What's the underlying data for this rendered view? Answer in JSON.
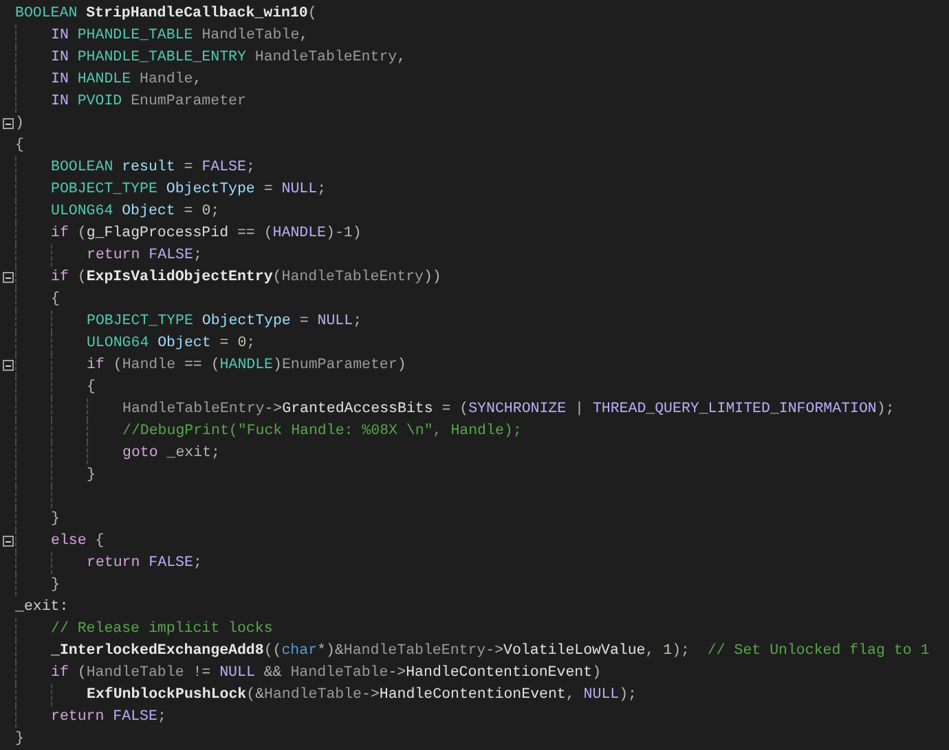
{
  "editor": {
    "lines": [
      {
        "kind": "code",
        "tokens": [
          {
            "text": "BOOLEAN ",
            "kind": "type"
          },
          {
            "text": "StripHandleCallback_win10",
            "kind": "function"
          },
          {
            "text": "(",
            "kind": "plain"
          }
        ],
        "children": [
          {
            "kind": "code",
            "tokens": [
              {
                "text": "IN ",
                "kind": "macro"
              },
              {
                "text": "PHANDLE_TABLE ",
                "kind": "type"
              },
              {
                "text": "HandleTable",
                "kind": "param"
              },
              {
                "text": ",",
                "kind": "plain"
              }
            ]
          },
          {
            "kind": "code",
            "tokens": [
              {
                "text": "IN ",
                "kind": "macro"
              },
              {
                "text": "PHANDLE_TABLE_ENTRY ",
                "kind": "type"
              },
              {
                "text": "HandleTableEntry",
                "kind": "param"
              },
              {
                "text": ",",
                "kind": "plain"
              }
            ]
          },
          {
            "kind": "code",
            "tokens": [
              {
                "text": "IN ",
                "kind": "macro"
              },
              {
                "text": "HANDLE ",
                "kind": "type"
              },
              {
                "text": "Handle",
                "kind": "param"
              },
              {
                "text": ",",
                "kind": "plain"
              }
            ]
          },
          {
            "kind": "code",
            "tokens": [
              {
                "text": "IN ",
                "kind": "macro"
              },
              {
                "text": "PVOID ",
                "kind": "type"
              },
              {
                "text": "EnumParameter",
                "kind": "param"
              }
            ]
          }
        ]
      },
      {
        "kind": "code",
        "expanded": true,
        "tokens": [
          {
            "text": ")",
            "kind": "plain"
          }
        ]
      },
      {
        "kind": "code",
        "tokens": [
          {
            "text": "{",
            "kind": "plain"
          }
        ],
        "children": [
          {
            "kind": "code",
            "tokens": [
              {
                "text": "BOOLEAN ",
                "kind": "type"
              },
              {
                "text": "result",
                "kind": "local"
              },
              {
                "text": " = ",
                "kind": "plain"
              },
              {
                "text": "FALSE",
                "kind": "macro"
              },
              {
                "text": ";",
                "kind": "plain"
              }
            ]
          },
          {
            "kind": "code",
            "tokens": [
              {
                "text": "POBJECT_TYPE ",
                "kind": "type"
              },
              {
                "text": "ObjectType",
                "kind": "local"
              },
              {
                "text": " = ",
                "kind": "plain"
              },
              {
                "text": "NULL",
                "kind": "macro"
              },
              {
                "text": ";",
                "kind": "plain"
              }
            ]
          },
          {
            "kind": "code",
            "tokens": [
              {
                "text": "ULONG64 ",
                "kind": "type"
              },
              {
                "text": "Object",
                "kind": "local"
              },
              {
                "text": " = ",
                "kind": "plain"
              },
              {
                "text": "0",
                "kind": "number"
              },
              {
                "text": ";",
                "kind": "plain"
              }
            ]
          },
          {
            "kind": "code",
            "tokens": [
              {
                "text": "if",
                "kind": "control"
              },
              {
                "text": " (",
                "kind": "plain"
              },
              {
                "text": "g_FlagProcessPid",
                "kind": "global"
              },
              {
                "text": " == (",
                "kind": "plain"
              },
              {
                "text": "HANDLE",
                "kind": "macro"
              },
              {
                "text": ")-1)",
                "kind": "plain"
              }
            ],
            "children": [
              {
                "kind": "code",
                "tokens": [
                  {
                    "text": "return ",
                    "kind": "control"
                  },
                  {
                    "text": "FALSE",
                    "kind": "macro"
                  },
                  {
                    "text": ";",
                    "kind": "plain"
                  }
                ]
              }
            ]
          },
          {
            "kind": "code",
            "expanded": true,
            "tokens": [
              {
                "text": "if",
                "kind": "control"
              },
              {
                "text": " (",
                "kind": "plain"
              },
              {
                "text": "ExpIsValidObjectEntry",
                "kind": "function"
              },
              {
                "text": "(",
                "kind": "plain"
              },
              {
                "text": "HandleTableEntry",
                "kind": "param"
              },
              {
                "text": "))",
                "kind": "plain"
              }
            ]
          },
          {
            "kind": "code",
            "tokens": [
              {
                "text": "{",
                "kind": "plain"
              }
            ],
            "children": [
              {
                "kind": "code",
                "tokens": [
                  {
                    "text": "POBJECT_TYPE ",
                    "kind": "type"
                  },
                  {
                    "text": "ObjectType",
                    "kind": "local"
                  },
                  {
                    "text": " = ",
                    "kind": "plain"
                  },
                  {
                    "text": "NULL",
                    "kind": "macro"
                  },
                  {
                    "text": ";",
                    "kind": "plain"
                  }
                ]
              },
              {
                "kind": "code",
                "tokens": [
                  {
                    "text": "ULONG64 ",
                    "kind": "type"
                  },
                  {
                    "text": "Object",
                    "kind": "local"
                  },
                  {
                    "text": " = ",
                    "kind": "plain"
                  },
                  {
                    "text": "0",
                    "kind": "number"
                  },
                  {
                    "text": ";",
                    "kind": "plain"
                  }
                ]
              },
              {
                "kind": "code",
                "expanded": true,
                "tokens": [
                  {
                    "text": "if",
                    "kind": "control"
                  },
                  {
                    "text": " (",
                    "kind": "plain"
                  },
                  {
                    "text": "Handle",
                    "kind": "param"
                  },
                  {
                    "text": " == (",
                    "kind": "plain"
                  },
                  {
                    "text": "HANDLE",
                    "kind": "type"
                  },
                  {
                    "text": ")",
                    "kind": "plain"
                  },
                  {
                    "text": "EnumParameter",
                    "kind": "param"
                  },
                  {
                    "text": ")",
                    "kind": "plain"
                  }
                ]
              },
              {
                "kind": "code",
                "tokens": [
                  {
                    "text": "{",
                    "kind": "plain"
                  }
                ],
                "children": [
                  {
                    "kind": "code",
                    "tokens": [
                      {
                        "text": "HandleTableEntry",
                        "kind": "param"
                      },
                      {
                        "text": "->",
                        "kind": "plain"
                      },
                      {
                        "text": "GrantedAccessBits",
                        "kind": "field"
                      },
                      {
                        "text": " = (",
                        "kind": "plain"
                      },
                      {
                        "text": "SYNCHRONIZE",
                        "kind": "macro"
                      },
                      {
                        "text": " | ",
                        "kind": "plain"
                      },
                      {
                        "text": "THREAD_QUERY_LIMITED_INFORMATION",
                        "kind": "macro"
                      },
                      {
                        "text": ");",
                        "kind": "plain"
                      }
                    ]
                  },
                  {
                    "kind": "code",
                    "tokens": [
                      {
                        "text": "//DebugPrint(\"Fuck Handle: %08X \\n\", Handle);",
                        "kind": "comment"
                      }
                    ]
                  },
                  {
                    "kind": "code",
                    "tokens": [
                      {
                        "text": "goto",
                        "kind": "control"
                      },
                      {
                        "text": " _exit;",
                        "kind": "plain"
                      }
                    ]
                  }
                ]
              },
              {
                "kind": "code",
                "tokens": [
                  {
                    "text": "}",
                    "kind": "plain"
                  }
                ]
              },
              {
                "kind": "blank"
              }
            ]
          },
          {
            "kind": "code",
            "tokens": [
              {
                "text": "}",
                "kind": "plain"
              }
            ]
          },
          {
            "kind": "code",
            "expanded": true,
            "tokens": [
              {
                "text": "else",
                "kind": "control"
              },
              {
                "text": " {",
                "kind": "plain"
              }
            ],
            "children": [
              {
                "kind": "code",
                "tokens": [
                  {
                    "text": "return ",
                    "kind": "control"
                  },
                  {
                    "text": "FALSE",
                    "kind": "macro"
                  },
                  {
                    "text": ";",
                    "kind": "plain"
                  }
                ]
              }
            ]
          },
          {
            "kind": "code",
            "tokens": [
              {
                "text": "}",
                "kind": "plain"
              }
            ]
          }
        ]
      },
      {
        "kind": "code",
        "tokens": [
          {
            "text": "_exit:",
            "kind": "label"
          }
        ],
        "children": [
          {
            "kind": "code",
            "tokens": [
              {
                "text": "// Release implicit locks",
                "kind": "comment"
              }
            ]
          },
          {
            "kind": "code",
            "tokens": [
              {
                "text": "_InterlockedExchangeAdd8",
                "kind": "function"
              },
              {
                "text": "((",
                "kind": "plain"
              },
              {
                "text": "char",
                "kind": "keyword"
              },
              {
                "text": "*)&",
                "kind": "plain"
              },
              {
                "text": "HandleTableEntry",
                "kind": "param"
              },
              {
                "text": "->",
                "kind": "plain"
              },
              {
                "text": "VolatileLowValue",
                "kind": "field"
              },
              {
                "text": ", ",
                "kind": "plain"
              },
              {
                "text": "1",
                "kind": "number"
              },
              {
                "text": ");  ",
                "kind": "plain"
              },
              {
                "text": "// Set Unlocked flag to 1",
                "kind": "comment"
              }
            ]
          },
          {
            "kind": "code",
            "tokens": [
              {
                "text": "if",
                "kind": "control"
              },
              {
                "text": " (",
                "kind": "plain"
              },
              {
                "text": "HandleTable",
                "kind": "param"
              },
              {
                "text": " != ",
                "kind": "plain"
              },
              {
                "text": "NULL",
                "kind": "macro"
              },
              {
                "text": " && ",
                "kind": "plain"
              },
              {
                "text": "HandleTable",
                "kind": "param"
              },
              {
                "text": "->",
                "kind": "plain"
              },
              {
                "text": "HandleContentionEvent",
                "kind": "field"
              },
              {
                "text": ")",
                "kind": "plain"
              }
            ],
            "children": [
              {
                "kind": "code",
                "tokens": [
                  {
                    "text": "ExfUnblockPushLock",
                    "kind": "function"
                  },
                  {
                    "text": "(&",
                    "kind": "plain"
                  },
                  {
                    "text": "HandleTable",
                    "kind": "param"
                  },
                  {
                    "text": "->",
                    "kind": "plain"
                  },
                  {
                    "text": "HandleContentionEvent",
                    "kind": "field"
                  },
                  {
                    "text": ", ",
                    "kind": "plain"
                  },
                  {
                    "text": "NULL",
                    "kind": "macro"
                  },
                  {
                    "text": ");",
                    "kind": "plain"
                  }
                ]
              }
            ]
          },
          {
            "kind": "code",
            "tokens": [
              {
                "text": "return ",
                "kind": "control"
              },
              {
                "text": "FALSE",
                "kind": "macro"
              },
              {
                "text": ";",
                "kind": "plain"
              }
            ]
          }
        ]
      },
      {
        "kind": "code",
        "tokens": [
          {
            "text": "}",
            "kind": "plain"
          }
        ]
      }
    ]
  }
}
